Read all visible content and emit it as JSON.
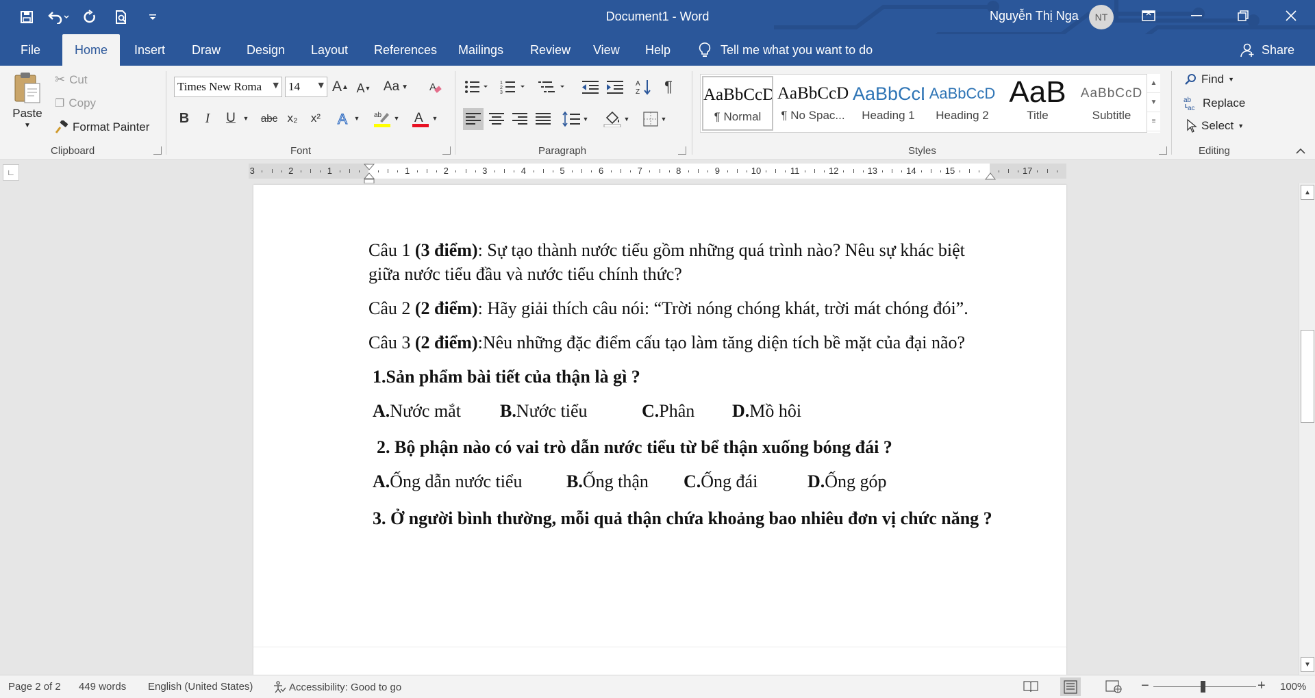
{
  "window": {
    "title": "Document1  -  Word",
    "user_name": "Nguyễn Thị Nga",
    "user_initials": "NT"
  },
  "tabs": [
    "File",
    "Home",
    "Insert",
    "Draw",
    "Design",
    "Layout",
    "References",
    "Mailings",
    "Review",
    "View",
    "Help"
  ],
  "tell_me": "Tell me what you want to do",
  "share": "Share",
  "clipboard": {
    "paste": "Paste",
    "cut": "Cut",
    "copy": "Copy",
    "format_painter": "Format Painter",
    "label": "Clipboard"
  },
  "font": {
    "name": "Times New Roma",
    "size": "14",
    "label": "Font",
    "case_label": "Aa",
    "bold": "B",
    "italic": "I",
    "underline": "U",
    "strike": "abc",
    "subscript": "x₂",
    "superscript": "x²"
  },
  "paragraph": {
    "label": "Paragraph"
  },
  "styles": {
    "label": "Styles",
    "items": [
      {
        "preview": "AaBbCcDd",
        "name": "¶ Normal"
      },
      {
        "preview": "AaBbCcDd",
        "name": "¶ No Spac..."
      },
      {
        "preview": "AaBbCcD",
        "name": "Heading 1"
      },
      {
        "preview": "AaBbCcD",
        "name": "Heading 2"
      },
      {
        "preview": "AaB",
        "name": "Title"
      },
      {
        "preview": "AaBbCcD",
        "name": "Subtitle"
      }
    ]
  },
  "editing": {
    "label": "Editing",
    "find": "Find",
    "replace": "Replace",
    "select": "Select"
  },
  "ruler": {
    "left_numbers": [
      "3",
      "2",
      "1"
    ],
    "right_numbers": [
      "1",
      "2",
      "3",
      "4",
      "5",
      "6",
      "7",
      "8",
      "9",
      "10",
      "11",
      "12",
      "13",
      "14",
      "15",
      "17"
    ]
  },
  "document": {
    "q1_prefix": "Câu 1 ",
    "q1_bold": "(3 điểm)",
    "q1_text": ": Sự tạo thành nước tiểu gồm những quá trình nào? Nêu sự khác biệt giữa nước tiểu đầu và nước tiểu chính thức?",
    "q2_prefix": "Câu 2 ",
    "q2_bold": "(2 điểm)",
    "q2_text": ":  Hãy giải thích câu nói: “Trời nóng chóng khát, trời mát chóng đói”.",
    "q3_prefix": "Câu 3 ",
    "q3_bold": "(2 điểm)",
    "q3_text": ":Nêu những đặc điểm cấu tạo làm tăng diện tích bề mặt của đại não?",
    "mc1_question": "1.Sản phẩm bài tiết của thận là gì ?",
    "mc1_answers": [
      {
        "letter": "A.",
        "text": " Nước mắt"
      },
      {
        "letter": "B.",
        "text": " Nước tiểu"
      },
      {
        "letter": "C.",
        "text": " Phân"
      },
      {
        "letter": "D.",
        "text": " Mồ hôi"
      }
    ],
    "mc2_question": "2. Bộ phận nào có vai trò dẫn nước tiểu từ bể thận xuống bóng đái ?",
    "mc2_answers": [
      {
        "letter": "A.",
        "text": " Ống dẫn nước tiểu"
      },
      {
        "letter": "B.",
        "text": " Ống thận"
      },
      {
        "letter": "C.",
        "text": " Ống đái"
      },
      {
        "letter": "D.",
        "text": " Ống góp"
      }
    ],
    "mc3_question": "3. Ở người bình thường, mỗi quả thận chứa khoảng bao nhiêu đơn vị chức năng ?"
  },
  "status": {
    "page": "Page 2 of 2",
    "words": "449 words",
    "language": "English (United States)",
    "accessibility": "Accessibility: Good to go",
    "zoom": "100%"
  },
  "colors": {
    "title_bar": "#2b579a",
    "ribbon": "#f3f3f3",
    "font_color_bar": "#e81123",
    "highlight_bar": "#ffff00"
  }
}
